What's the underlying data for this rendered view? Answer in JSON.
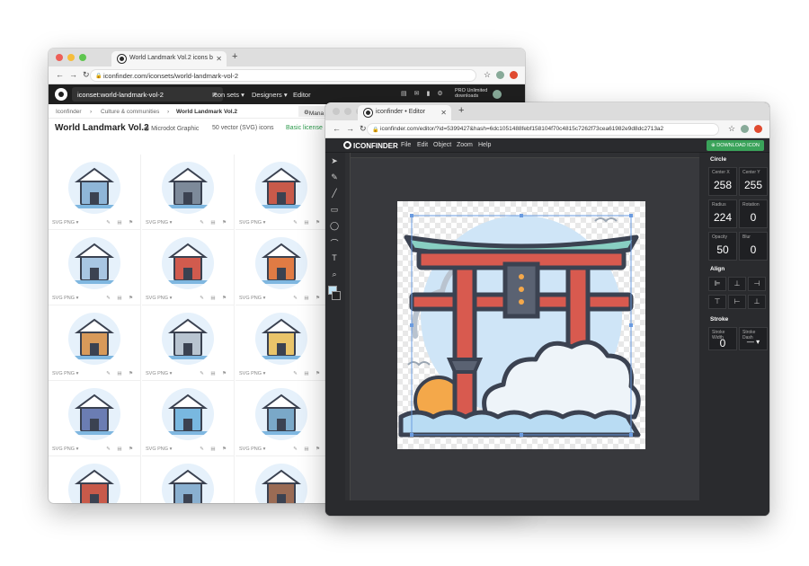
{
  "window1": {
    "tab_title": "World Landmark Vol.2 icons b",
    "url": "iconfinder.com/iconsets/world-landmark-vol-2",
    "search_value": "iconset:world-landmark-vol-2",
    "menu": [
      "Icon sets ▾",
      "Designers ▾",
      "Editor"
    ],
    "pro_line1": "PRO Unlimited",
    "pro_line2": "downloads",
    "breadcrumbs": [
      "Iconfinder",
      "›",
      "Culture & communities",
      "›",
      "World Landmark Vol.2"
    ],
    "manage_label": "Mana",
    "page_title": "World Landmark Vol.2",
    "designer": "Microdot Graphic",
    "count": "50 vector (SVG) icons",
    "license": "Basic license",
    "cell_caption": "SVG  PNG  ▾",
    "cell_tools": "✎ ▤ ⚑",
    "icon_colors": [
      "#8fb6d8",
      "#7d8a9a",
      "#c85a4a",
      "#a8c6e2",
      "#d15b4e",
      "#e07b44",
      "#d89a5a",
      "#b8c4d0",
      "#e9c46a",
      "#6b7db3",
      "#79b8e0",
      "#7aa8c8",
      "#c85a4a",
      "#8ab0d0",
      "#9a6b54"
    ]
  },
  "window2": {
    "tab_title": "iconfinder • Editor",
    "url": "iconfinder.com/editor/?id=5399427&hash=6dc1051488febf158104f70c4815c7262f73cea61982e9d8dc2713a2",
    "logo": "ICONFINDER",
    "menu": [
      "File",
      "Edit",
      "Object",
      "Zoom",
      "Help"
    ],
    "download_label": "⊕ DOWNLOAD ICON",
    "tools": [
      "➤",
      "✎",
      "╱",
      "▭",
      "◯",
      "⌒",
      "T",
      "⌕"
    ],
    "panel": {
      "circle_title": "Circle",
      "center_x_label": "Center X",
      "center_x": "258",
      "center_y_label": "Center Y",
      "center_y": "255",
      "radius_label": "Radius",
      "radius": "224",
      "rotation_label": "Rotation",
      "rotation": "0",
      "opacity_label": "Opacity",
      "opacity": "50",
      "blur_label": "Blur",
      "blur": "0",
      "align_title": "Align",
      "align_icons": [
        "⊫",
        "⊥",
        "⊣",
        "⊤",
        "⊢",
        "⊥"
      ],
      "stroke_title": "Stroke",
      "stroke_width_label": "Stroke Width",
      "stroke_width": "0",
      "stroke_dash_label": "Stroke Dash",
      "stroke_dash": "— ▾"
    }
  },
  "colors": {
    "torii_red": "#d85a4f",
    "torii_dark": "#3b4251",
    "torii_teal": "#88cfc2",
    "sky": "#cfe5f7",
    "sun": "#f4a84a",
    "water": "#b9dcf3"
  }
}
